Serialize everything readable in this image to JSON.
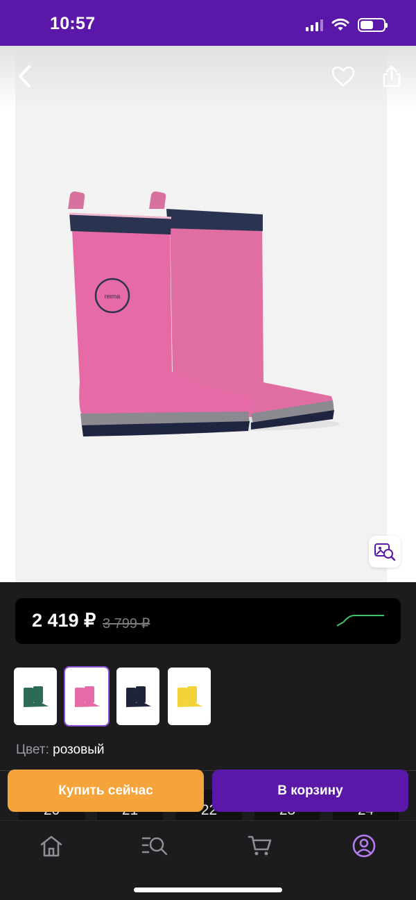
{
  "status_bar": {
    "time": "10:57",
    "icons": [
      "signal-icon",
      "wifi-icon",
      "battery-icon"
    ],
    "battery_level": 0.55
  },
  "product_image": {
    "description_icons": [
      "back-arrow-icon",
      "heart-icon",
      "share-icon",
      "visual-search-icon"
    ],
    "brand_badge": "reima"
  },
  "price": {
    "current": "2 419 ₽",
    "old": "3 799 ₽",
    "trend_color": "#3ec46d"
  },
  "colors": {
    "label": "Цвет:",
    "selected": "розовый",
    "variants": [
      {
        "name": "green",
        "color": "#2e6b56"
      },
      {
        "name": "pink",
        "color": "#e56aa6"
      },
      {
        "name": "navy",
        "color": "#1f2538"
      },
      {
        "name": "yellow",
        "color": "#f2d33a"
      }
    ],
    "selected_index": 1
  },
  "sizes": [
    "20",
    "21",
    "22",
    "23",
    "24"
  ],
  "actions": {
    "buy_now": "Купить сейчас",
    "add_to_cart": "В корзину",
    "buy_color": "#f4a43a",
    "cart_color": "#5b17a8"
  },
  "tab_bar": {
    "tabs": [
      "home-icon",
      "catalog-search-icon",
      "cart-icon",
      "profile-icon"
    ],
    "active_index": 3,
    "active_color": "#b57cf0"
  }
}
